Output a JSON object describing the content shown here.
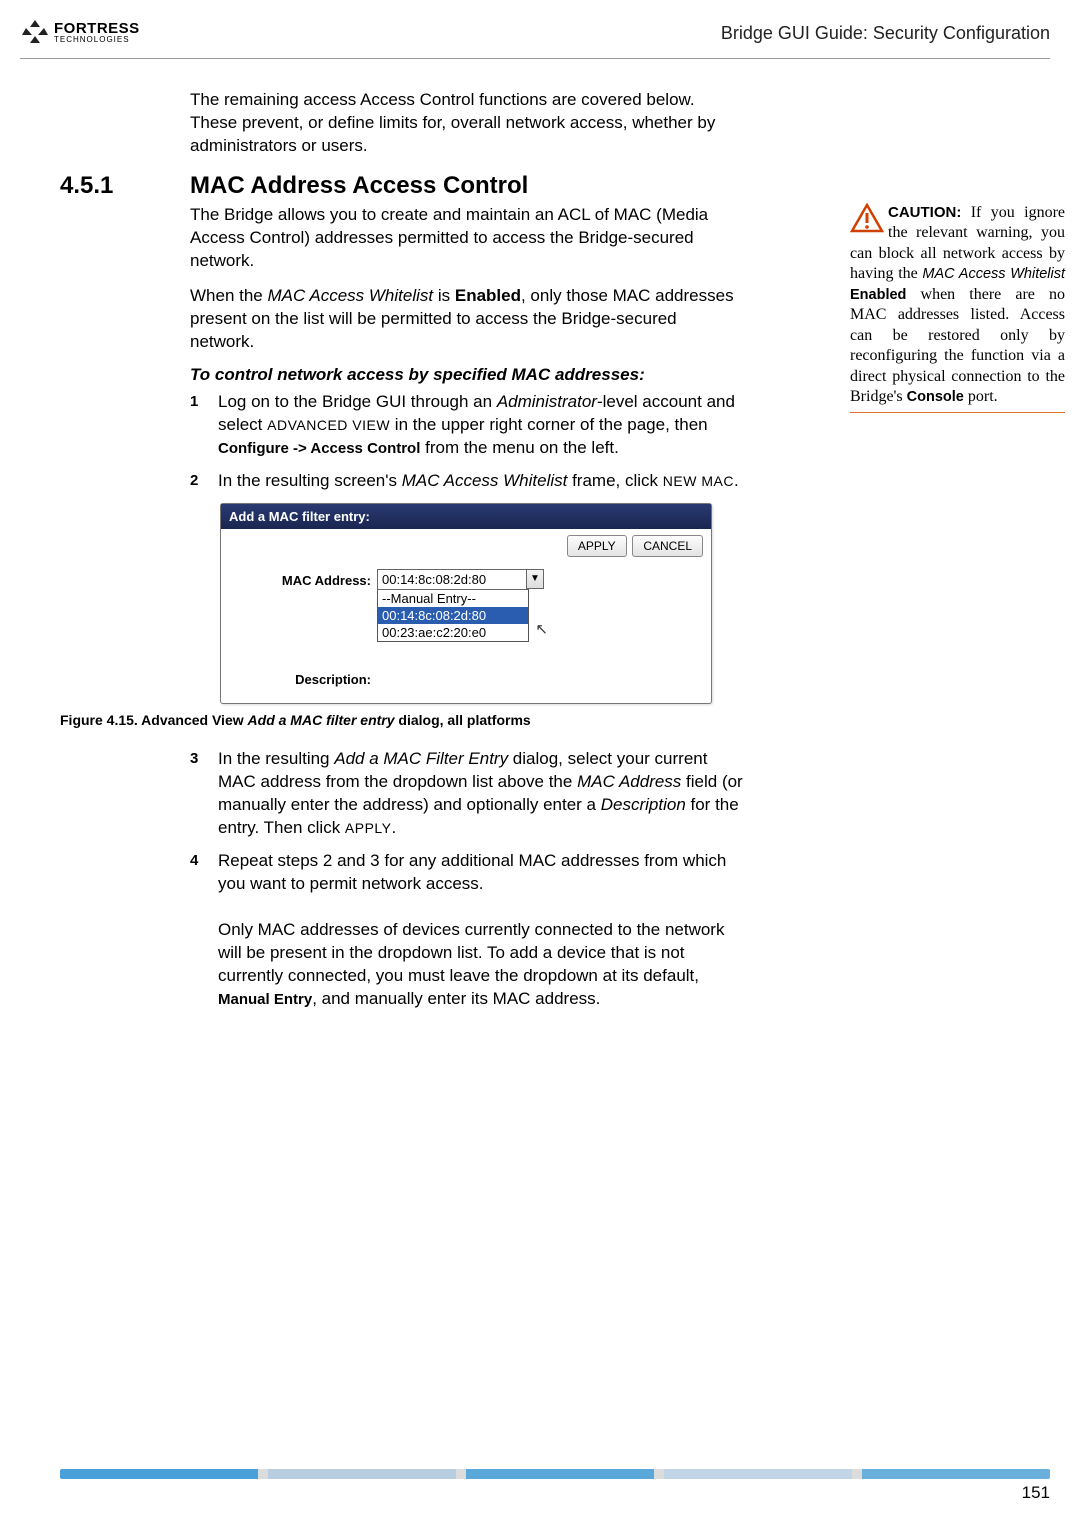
{
  "header": {
    "logo_main": "FORTRESS",
    "logo_sub": "TECHNOLOGIES",
    "title": "Bridge GUI Guide: Security Configuration"
  },
  "intro": "The remaining access Access Control functions are covered below. These prevent, or define limits for, overall network access, whether by administrators or users.",
  "section": {
    "num": "4.5.1",
    "title": "MAC Address Access Control"
  },
  "paras": {
    "p1": "The Bridge allows you to create and maintain an ACL of MAC (Media Access Control) addresses permitted to access the Bridge-secured network.",
    "p2_a": "When the ",
    "p2_term": "MAC Access Whitelist",
    "p2_b": " is ",
    "p2_bold": "Enabled",
    "p2_c": ", only those MAC addresses present on the list will be permitted to access the Bridge-secured network."
  },
  "proc_heading": "To control network access by specified MAC addresses:",
  "steps": {
    "s1_a": "Log on to the Bridge GUI through an ",
    "s1_term1": "Administrator",
    "s1_b": "-level account and select ",
    "s1_sc1": "ADVANCED VIEW",
    "s1_c": " in the upper right corner of the page, then ",
    "s1_bold1": "Configure -> Access Control",
    "s1_d": " from the menu on the left.",
    "s2_a": "In the resulting screen's ",
    "s2_term1": "MAC Access Whitelist",
    "s2_b": " frame, click ",
    "s2_sc1": "NEW MAC",
    "s2_c": ".",
    "s3_a": "In the resulting ",
    "s3_term1": "Add a MAC Filter Entry",
    "s3_b": " dialog, select your current MAC address from the dropdown list above the ",
    "s3_term2": "MAC Address",
    "s3_c": " field (or manually enter the address) and optionally enter a ",
    "s3_term3": "Description",
    "s3_d": " for the entry. Then click ",
    "s3_sc1": "APPLY",
    "s3_e": ".",
    "s4_a": "Repeat steps 2 and 3 for any additional MAC addresses from which you want to permit network access.",
    "s4_b": "Only MAC addresses of devices currently connected to the network will be present in the dropdown list. To add a device that is not currently connected, you must leave the dropdown at its default, ",
    "s4_bold1": "Manual Entry",
    "s4_c": ", and manually enter its MAC address."
  },
  "dialog": {
    "title": "Add a MAC filter entry:",
    "apply": "APPLY",
    "cancel": "CANCEL",
    "mac_label": "MAC Address:",
    "desc_label": "Description:",
    "selected_value": "00:14:8c:08:2d:80",
    "options": [
      "--Manual Entry--",
      "00:14:8c:08:2d:80",
      "00:23:ae:c2:20:e0"
    ]
  },
  "figure_caption": {
    "a": "Figure 4.15. Advanced View ",
    "ital": "Add a MAC filter entry",
    "b": " dialog, all platforms"
  },
  "caution": {
    "label": "CAUTION:",
    "text_a": " If you ignore the relevant warning, you can block all network access by having the ",
    "term1": "MAC Access Whitelist",
    "space": " ",
    "bold1": "Enabled",
    "text_b": " when there are no MAC ad­dresses listed. Access can be restored only by reconfiguring the func­tion via a direct physical connection to the Bridge's ",
    "bold2": "Console",
    "text_c": " port."
  },
  "page_number": "151"
}
